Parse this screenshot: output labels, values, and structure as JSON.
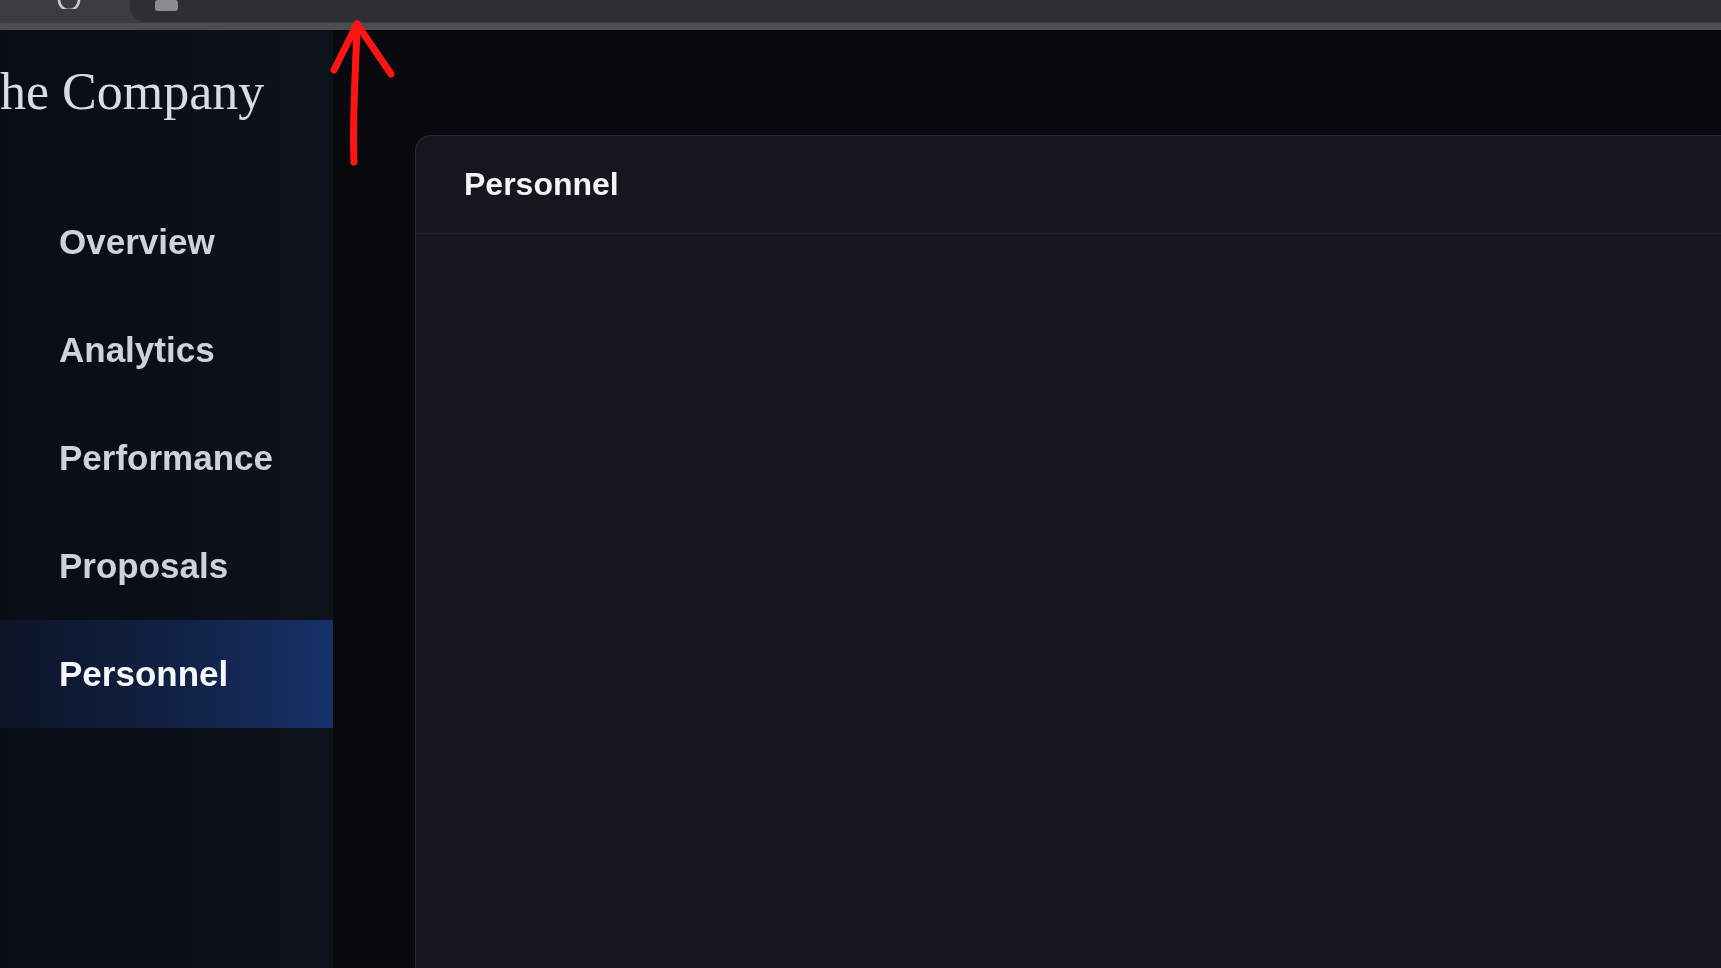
{
  "sidebar": {
    "title": "he Company",
    "items": [
      {
        "label": "Overview",
        "selected": false
      },
      {
        "label": "Analytics",
        "selected": false
      },
      {
        "label": "Performance",
        "selected": false
      },
      {
        "label": "Proposals",
        "selected": false
      },
      {
        "label": "Personnel",
        "selected": true
      }
    ]
  },
  "panel": {
    "title": "Personnel"
  }
}
